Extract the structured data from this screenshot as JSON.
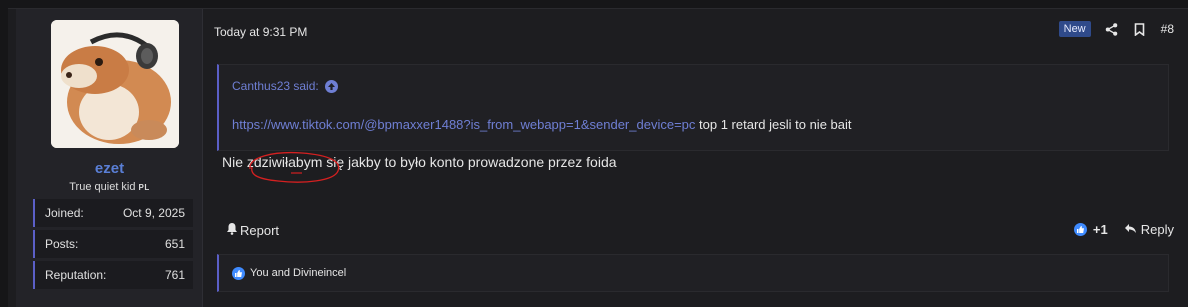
{
  "user": {
    "username": "ezet",
    "title": "True quiet kid",
    "flag": "PL",
    "stats": [
      {
        "label": "Joined:",
        "value": "Oct 9, 2025"
      },
      {
        "label": "Posts:",
        "value": "651"
      },
      {
        "label": "Reputation:",
        "value": "761"
      }
    ]
  },
  "post": {
    "date": "Today at 9:31 PM",
    "badge": "New",
    "number": "#8",
    "quote": {
      "attribution": "Canthus23 said:",
      "link": "https://www.tiktok.com/@bpmaxxer1488?is_from_webapp=1&sender_device=pc",
      "text": "top 1 retard jesli to nie bait"
    },
    "message": "Nie zdziwiłabym się jakby to było konto prowadzone przez foida",
    "actions": {
      "report": "Report",
      "like_count": "+1",
      "reply": "Reply"
    },
    "reactions": "You and Divineincel"
  },
  "colors": {
    "accent": "#5b5fc7",
    "link": "#6f7fd4",
    "username": "#5a7fd6",
    "annotation": "#d42020"
  }
}
